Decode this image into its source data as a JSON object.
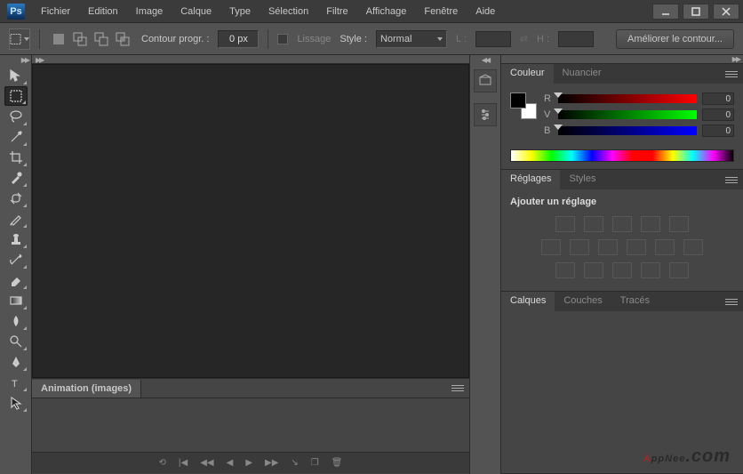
{
  "menu": [
    "Fichier",
    "Edition",
    "Image",
    "Calque",
    "Type",
    "Sélection",
    "Filtre",
    "Affichage",
    "Fenêtre",
    "Aide"
  ],
  "options": {
    "feather_label": "Contour progr. :",
    "feather_value": "0 px",
    "antialias_label": "Lissage",
    "style_label": "Style :",
    "style_value": "Normal",
    "width_label": "L :",
    "height_label": "H :",
    "refine_label": "Améliorer le contour..."
  },
  "animation": {
    "tab": "Animation (images)"
  },
  "color_panel": {
    "tabs": [
      "Couleur",
      "Nuancier"
    ],
    "channels": [
      {
        "k": "R",
        "v": "0",
        "cls": "r"
      },
      {
        "k": "V",
        "v": "0",
        "cls": "g"
      },
      {
        "k": "B",
        "v": "0",
        "cls": "b"
      }
    ]
  },
  "adjust_panel": {
    "tabs": [
      "Réglages",
      "Styles"
    ],
    "hint": "Ajouter un réglage"
  },
  "layers_panel": {
    "tabs": [
      "Calques",
      "Couches",
      "Tracés"
    ]
  }
}
